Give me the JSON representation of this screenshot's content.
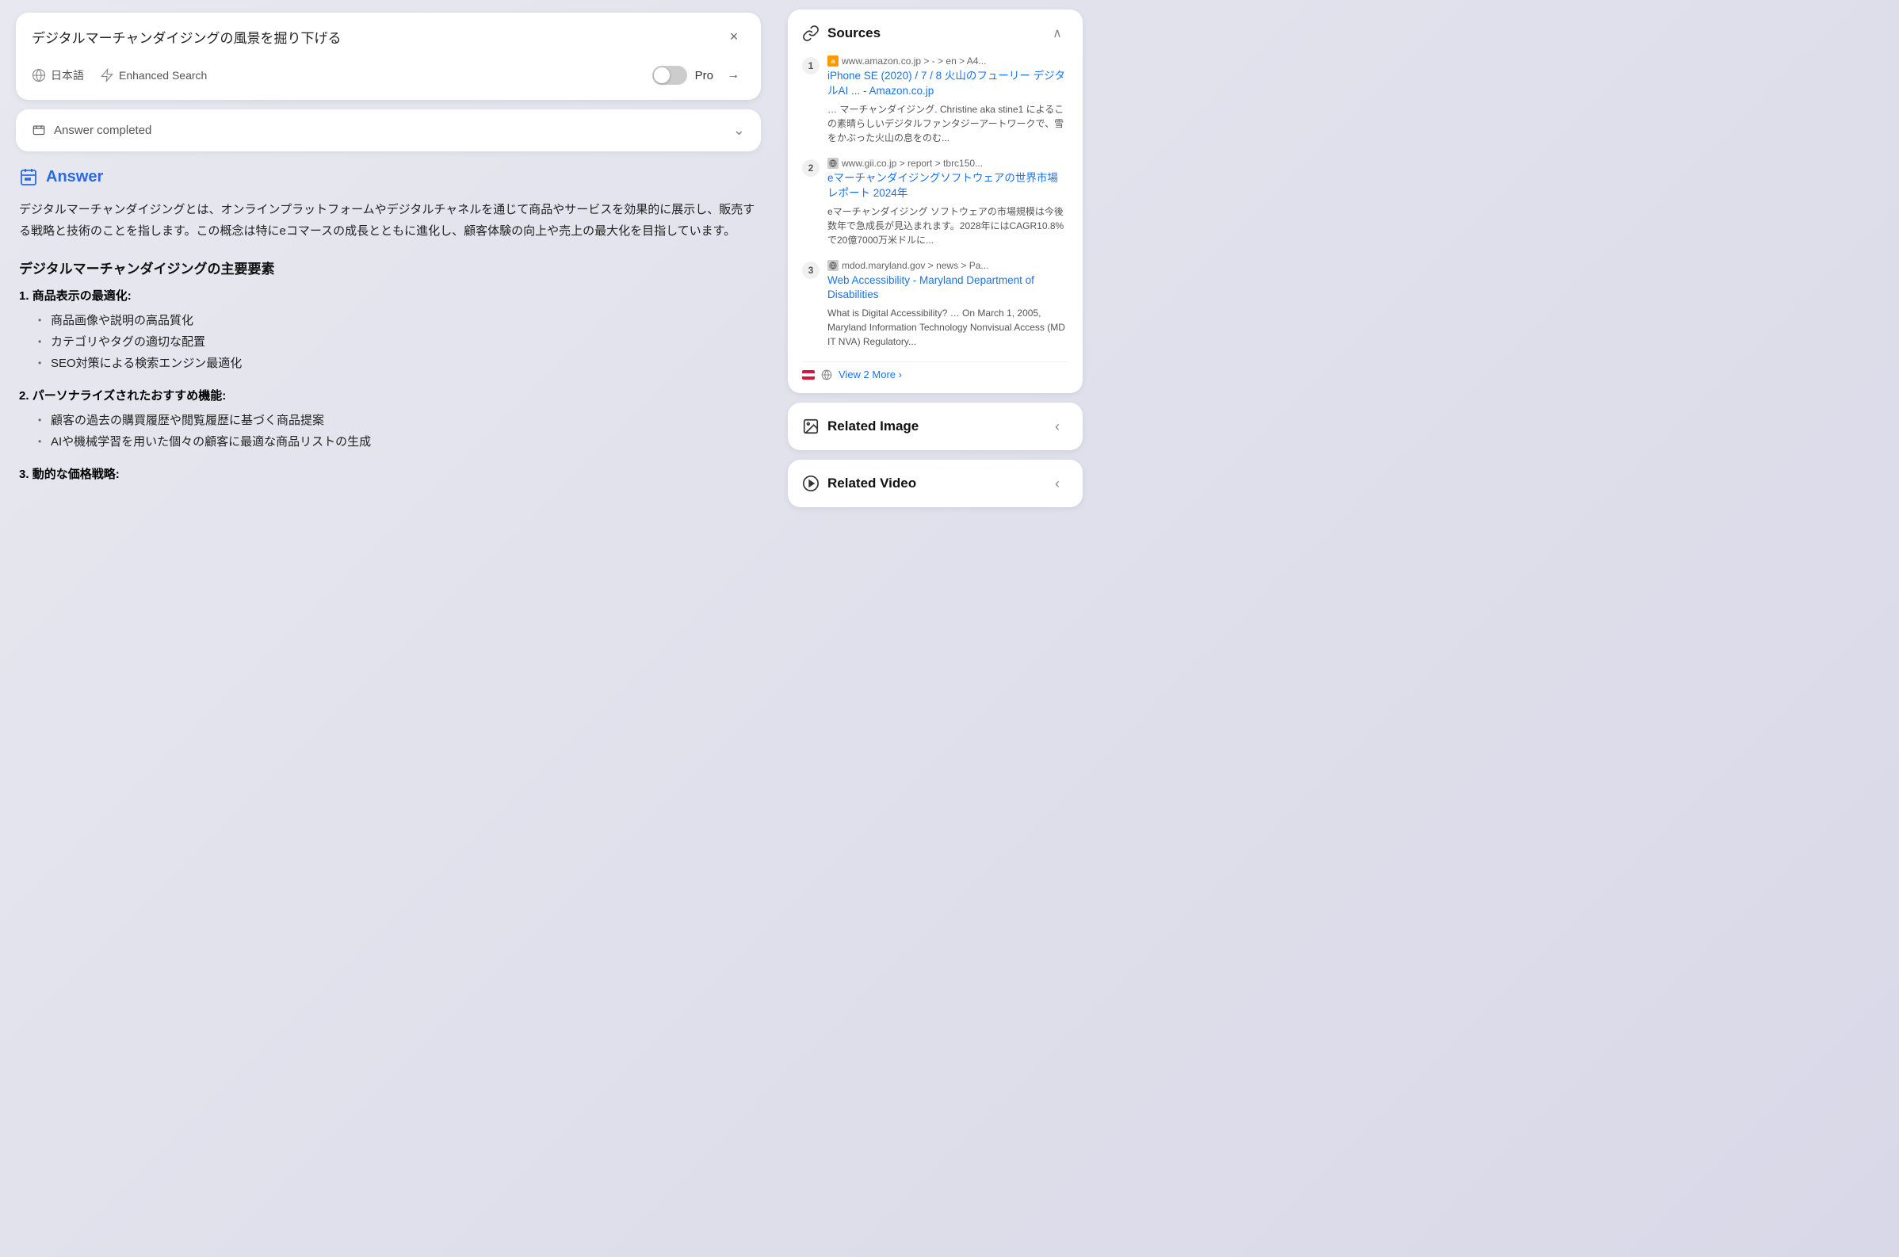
{
  "search": {
    "query": "デジタルマーチャンダイジングの風景を掘り下げる",
    "language": "日本語",
    "enhanced_search": "Enhanced Search",
    "pro_label": "Pro",
    "close_label": "×",
    "arrow_label": "→"
  },
  "answer_header": {
    "icon": "☰",
    "label": "Answer completed",
    "chevron": "⌄"
  },
  "answer": {
    "title": "Answer",
    "body": "デジタルマーチャンダイジングとは、オンラインプラットフォームやデジタルチャネルを通じて商品やサービスを効果的に展示し、販売する戦略と技術のことを指します。この概念は特にeコマースの成長とともに進化し、顧客体験の向上や売上の最大化を目指しています。",
    "section_heading": "デジタルマーチャンダイジングの主要要素",
    "items": [
      {
        "label": "商品表示の最適化:",
        "bullets": [
          "商品画像や説明の高品質化",
          "カテゴリやタグの適切な配置",
          "SEO対策による検索エンジン最適化"
        ]
      },
      {
        "label": "パーソナライズされたおすすめ機能:",
        "bullets": [
          "顧客の過去の購買履歴や閲覧履歴に基づく商品提案",
          "AIや機械学習を用いた個々の顧客に最適な商品リストの生成"
        ]
      },
      {
        "label": "動的な価格戦略:",
        "bullets": []
      }
    ]
  },
  "sidebar": {
    "sources": {
      "title": "Sources",
      "items": [
        {
          "number": "1",
          "favicon": "a",
          "url": "www.amazon.co.jp > - > en > A4...",
          "title": "iPhone SE (2020) / 7 / 8 火山のフューリー デジタルAI ... - Amazon.co.jp",
          "snippet": "… マーチャンダイジング. Christine aka stine1 によるこの素晴らしいデジタルファンタジーアートワークで、雪をかぶった火山の息をのむ..."
        },
        {
          "number": "2",
          "favicon": "g",
          "url": "www.gii.co.jp > report > tbrc150...",
          "title": "eマーチャンダイジングソフトウェアの世界市場レポート 2024年",
          "snippet": "eマーチャンダイジング ソフトウェアの市場規模は今後数年で急成長が見込まれます。2028年にはCAGR10.8%で20億7000万米ドルに..."
        },
        {
          "number": "3",
          "favicon": "m",
          "url": "mdod.maryland.gov > news > Pa...",
          "title": "Web Accessibility - Maryland Department of Disabilities",
          "snippet": "What is Digital Accessibility? … On March 1, 2005, Maryland Information Technology Nonvisual Access (MD IT NVA) Regulatory..."
        }
      ],
      "view_more": "View 2 More ›"
    },
    "related_image": {
      "title": "Related Image"
    },
    "related_video": {
      "title": "Related Video"
    }
  }
}
